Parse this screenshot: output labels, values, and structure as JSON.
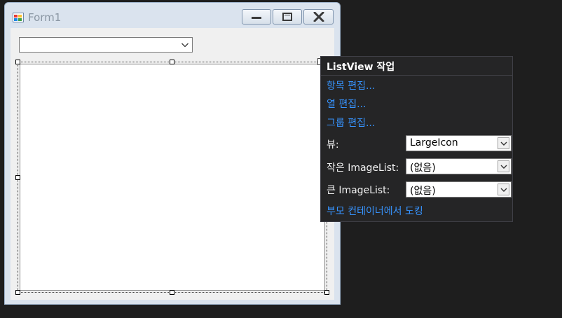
{
  "form": {
    "title": "Form1",
    "combo_value": ""
  },
  "smart_tag_panel": {
    "title": "ListView 작업",
    "links": {
      "edit_items": "항목 편집...",
      "edit_columns": "열 편집...",
      "edit_groups": "그룹 편집..."
    },
    "view": {
      "label": "뷰:",
      "value": "LargeIcon"
    },
    "small_imagelist": {
      "label": "작은 ImageList:",
      "value": "(없음)"
    },
    "large_imagelist": {
      "label": "큰 ImageList:",
      "value": "(없음)"
    },
    "dock_link": "부모 컨테이너에서 도킹"
  },
  "colors": {
    "link": "#3794ff",
    "panel_bg": "#252526",
    "ide_bg": "#1e1e1e",
    "form_frame": "#dae3ee"
  }
}
